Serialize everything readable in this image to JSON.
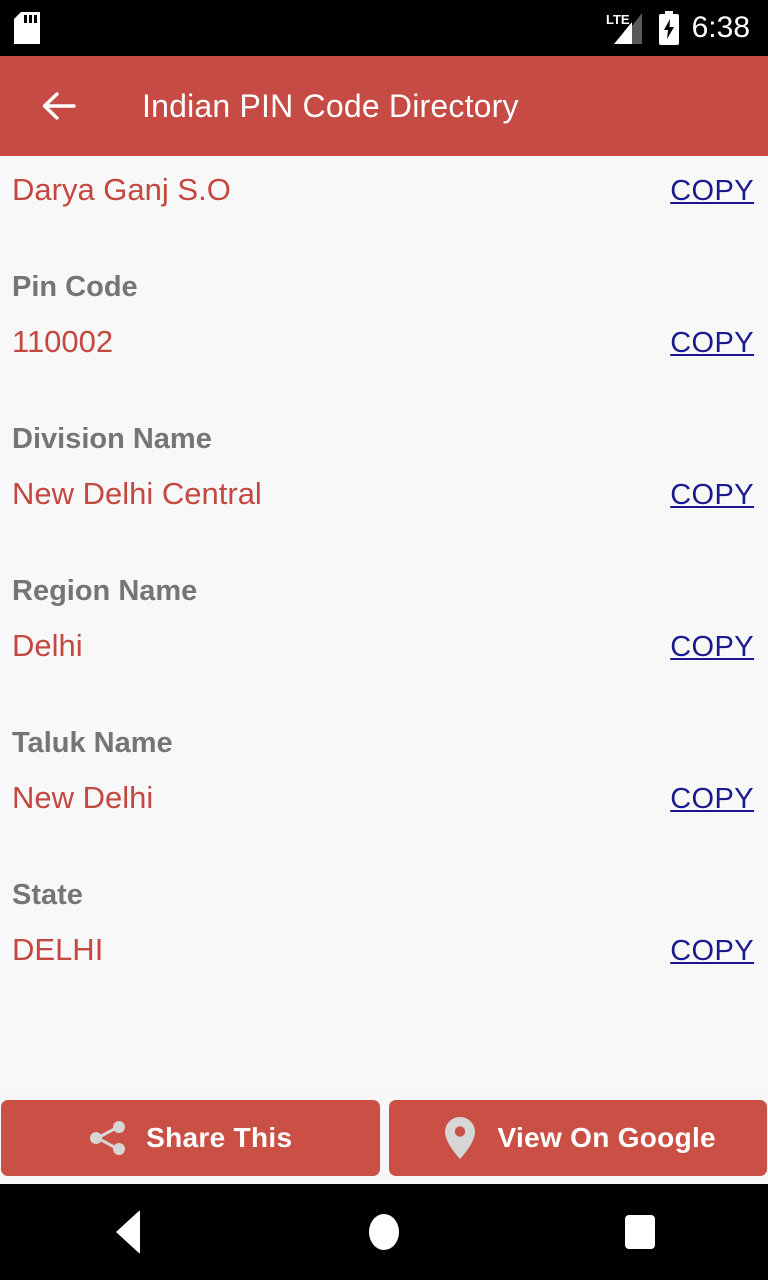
{
  "status_bar": {
    "sd_card_icon": "sd-card-icon",
    "network_type": "LTE",
    "signal_icon": "signal-bars-icon",
    "battery_icon": "battery-charging-icon",
    "time": "6:38"
  },
  "app_bar": {
    "back_icon": "back-arrow-icon",
    "title": "Indian PIN Code Directory"
  },
  "copy_label": "COPY",
  "details": {
    "office_name": "Darya Ganj S.O",
    "fields": [
      {
        "label": "Pin Code",
        "value": "110002"
      },
      {
        "label": "Division Name",
        "value": "New Delhi Central"
      },
      {
        "label": "Region Name",
        "value": "Delhi"
      },
      {
        "label": "Taluk Name",
        "value": "New Delhi"
      },
      {
        "label": "State",
        "value": "DELHI"
      }
    ]
  },
  "actions": {
    "share": {
      "label": "Share This",
      "icon": "share-icon"
    },
    "maps": {
      "label": "View On Google",
      "icon": "map-pin-icon"
    }
  },
  "nav_bar": {
    "back": "nav-back-icon",
    "home": "nav-home-icon",
    "recent": "nav-recent-apps-icon"
  },
  "colors": {
    "accent": "#c64b44",
    "value_text": "#c4483f",
    "label_text": "#757575",
    "link": "#1a1a8e",
    "background": "#f8f8f8"
  }
}
